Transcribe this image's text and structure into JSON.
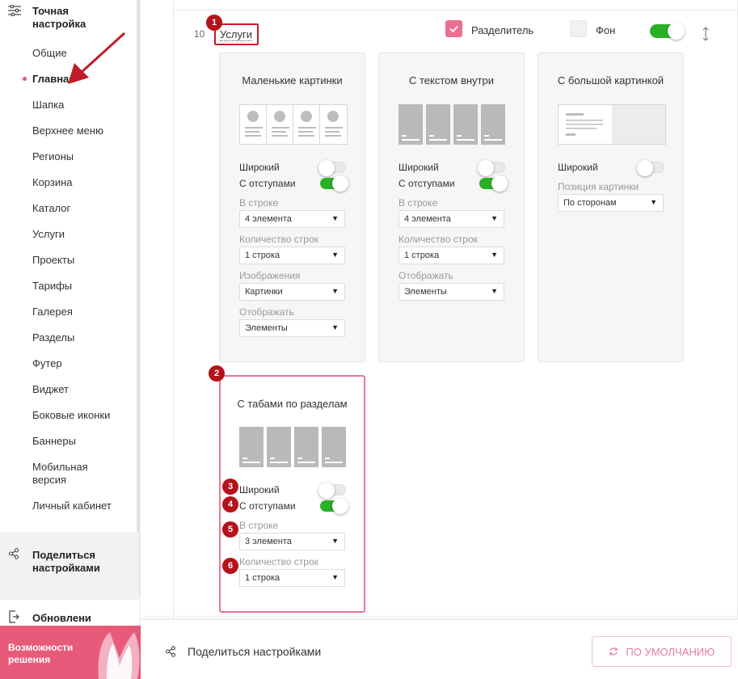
{
  "sidebar": {
    "title": "Точная настройка",
    "items": [
      "Общие",
      "Главная",
      "Шапка",
      "Верхнее меню",
      "Регионы",
      "Корзина",
      "Каталог",
      "Услуги",
      "Проекты",
      "Тарифы",
      "Галерея",
      "Разделы",
      "Футер",
      "Виджет",
      "Боковые иконки",
      "Баннеры",
      "Мобильная версия",
      "Личный кабинет"
    ],
    "active_item": "Главная",
    "share": "Поделиться настройками",
    "updates": "Обновлени",
    "promo": "Возможности решения"
  },
  "block": {
    "number": "10",
    "title": "Услуги",
    "separator_label": "Разделитель",
    "separator_checked": true,
    "background_label": "Фон",
    "background_checked": false,
    "enabled": true
  },
  "cards": [
    {
      "title": "Маленькие картинки",
      "wide_label": "Широкий",
      "wide": false,
      "padding_label": "С отступами",
      "padding": true,
      "per_row_label": "В строке",
      "per_row": "4 элемента",
      "rows_label": "Количество строк",
      "rows": "1 строка",
      "images_label": "Изображения",
      "images": "Картинки",
      "display_label": "Отображать",
      "display": "Элементы"
    },
    {
      "title": "С текстом внутри",
      "wide_label": "Широкий",
      "wide": false,
      "padding_label": "С отступами",
      "padding": true,
      "per_row_label": "В строке",
      "per_row": "4 элемента",
      "rows_label": "Количество строк",
      "rows": "1 строка",
      "display_label": "Отображать",
      "display": "Элементы"
    },
    {
      "title": "С большой картинкой",
      "wide_label": "Широкий",
      "wide": false,
      "position_label": "Позиция картинки",
      "position": "По сторонам"
    },
    {
      "title": "С табами по разделам",
      "selected": true,
      "wide_label": "Широкий",
      "wide": false,
      "padding_label": "С отступами",
      "padding": true,
      "per_row_label": "В строке",
      "per_row": "3 элемента",
      "rows_label": "Количество строк",
      "rows": "1 строка"
    }
  ],
  "annotations": [
    "1",
    "2",
    "3",
    "4",
    "5",
    "6"
  ],
  "footer": {
    "share": "Поделиться настройками",
    "reset": "ПО УМОЛЧАНИЮ"
  },
  "colors": {
    "accent": "#e8507a",
    "toggle_on": "#28b125",
    "badge": "#b5121b",
    "promo": "#e85a7a"
  }
}
